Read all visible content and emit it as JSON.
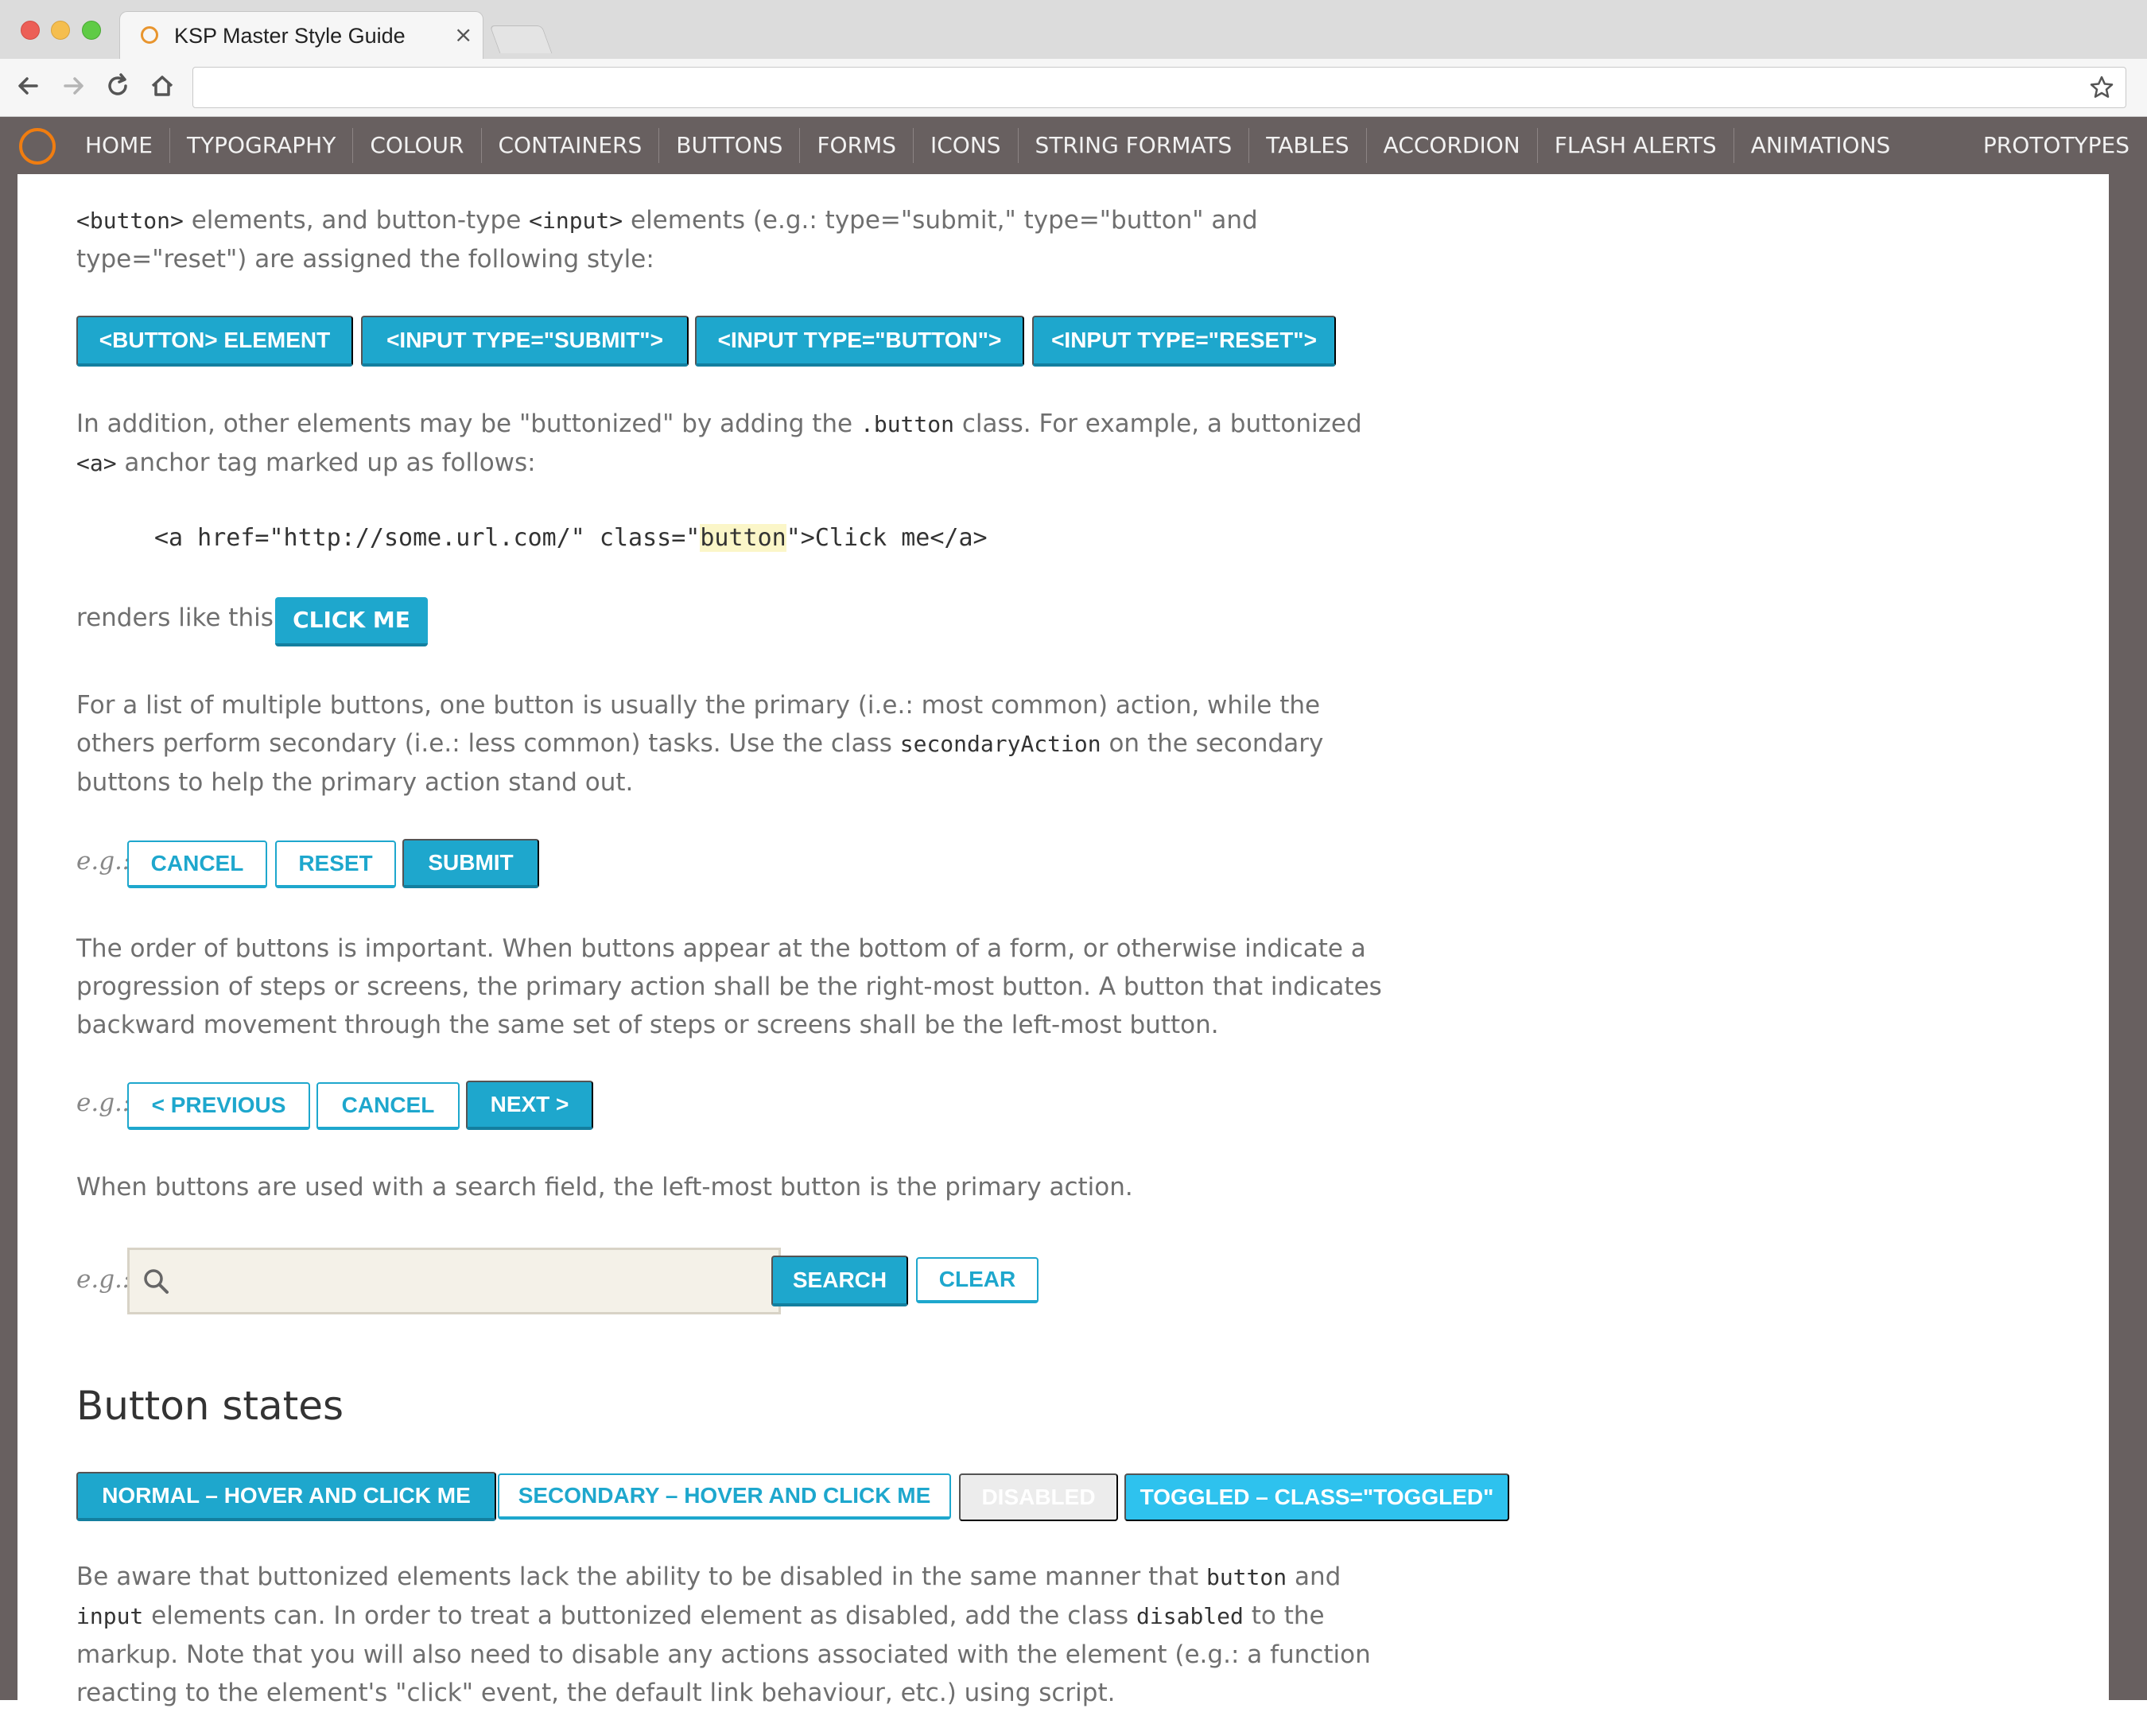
{
  "browser": {
    "tab_title": "KSP Master Style Guide",
    "tab_close": "×",
    "url": ""
  },
  "nav": {
    "items": [
      "HOME",
      "TYPOGRAPHY",
      "COLOUR",
      "CONTAINERS",
      "BUTTONS",
      "FORMS",
      "ICONS",
      "STRING FORMATS",
      "TABLES",
      "ACCORDION",
      "FLASH ALERTS",
      "ANIMATIONS"
    ],
    "right_item": "PROTOTYPES"
  },
  "content": {
    "intro": {
      "c1": "<button>",
      "t1": " elements, and button-type ",
      "c2": "<input>",
      "t2": " elements (e.g.: type=\"submit,\" type=\"button\" and type=\"reset\") are assigned the following style:"
    },
    "style_buttons": [
      "<BUTTON> ELEMENT",
      "<INPUT TYPE=\"SUBMIT\">",
      "<INPUT TYPE=\"BUTTON\">",
      "<INPUT TYPE=\"RESET\">"
    ],
    "buttonize": {
      "t1": "In addition, other elements may be \"buttonized\" by adding the ",
      "c1": ".button",
      "t2": " class. For example, a buttonized ",
      "c2": "<a>",
      "t3": " anchor tag marked up as follows:"
    },
    "code": {
      "pre": "<a href=\"http://some.url.com/\" class=\"",
      "highlight": "button",
      "post": "\">Click me</a>"
    },
    "renders_label": "renders like this:",
    "click_me": "CLICK ME",
    "multiple": {
      "t1": "For a list of multiple buttons, one button is usually the primary (i.e.: most common) action, while the others perform secondary (i.e.: less common) tasks. Use the class ",
      "c1": "secondaryAction",
      "t2": " on the secondary buttons to help the primary action stand out."
    },
    "eg_label": "e.g.:",
    "example1": {
      "cancel": "CANCEL",
      "reset": "RESET",
      "submit": "SUBMIT"
    },
    "order": "The order of buttons is important. When buttons appear at the bottom of a form, or otherwise indicate a progression of steps or screens, the primary action shall be the right-most button. A button that indicates backward movement through the same set of steps or screens shall be the left-most button.",
    "example2": {
      "previous": "< PREVIOUS",
      "cancel": "CANCEL",
      "next": "NEXT >"
    },
    "search_text": "When buttons are used with a search field, the left-most button is the primary action.",
    "example3": {
      "search": "SEARCH",
      "clear": "CLEAR",
      "placeholder": ""
    },
    "states_heading": "Button states",
    "states": {
      "normal": "NORMAL – HOVER AND CLICK ME",
      "secondary": "SECONDARY – HOVER AND CLICK ME",
      "disabled": "DISABLED",
      "toggled": "TOGGLED – CLASS=\"TOGGLED\""
    },
    "aware": {
      "t1": "Be aware that buttonized elements lack the ability to be disabled in the same manner that ",
      "c1": "button",
      "t2": " and ",
      "c2": "input",
      "t3": " elements can. In order to treat a buttonized element as disabled, add the class ",
      "c3": "disabled",
      "t4": " to the markup. Note that you will also need to disable any actions associated with the element (e.g.: a function reacting to the element's \"click\" event, the default link behaviour, etc.) using script."
    }
  },
  "colors": {
    "primary": "#1ea7cd",
    "nav_bg": "#686060",
    "toggled": "#2ec2ee",
    "logo": "#f07d10"
  }
}
